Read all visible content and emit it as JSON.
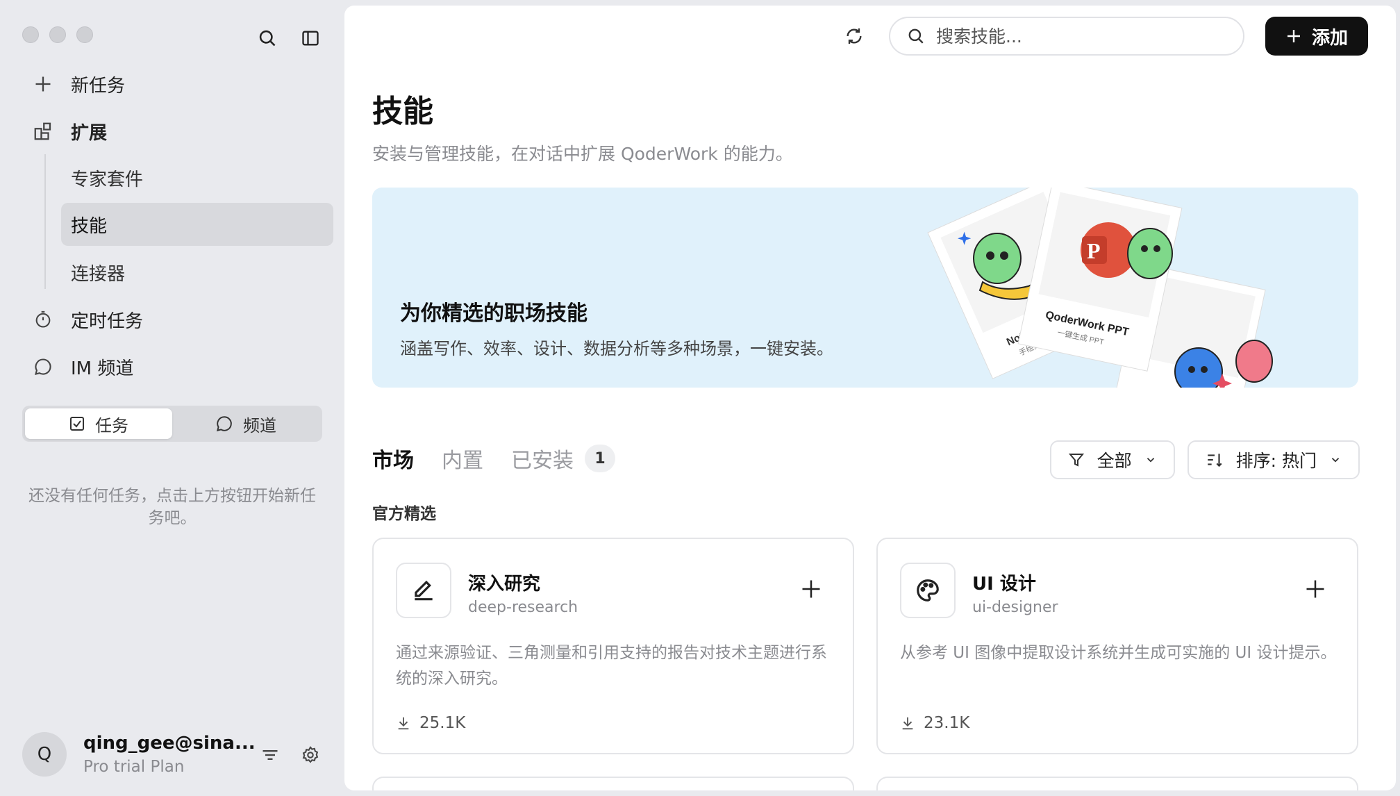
{
  "sidebar": {
    "nav": {
      "new_task": "新任务",
      "extensions": "扩展",
      "scheduled": "定时任务",
      "im_channels": "IM 频道"
    },
    "sub_items": [
      "专家套件",
      "技能",
      "连接器"
    ],
    "segment": {
      "tasks": "任务",
      "channels": "频道"
    },
    "empty_text": "还没有任何任务，点击上方按钮开始新任务吧。",
    "user": {
      "initial": "Q",
      "name": "qing_gee@sina...",
      "plan": "Pro trial Plan"
    }
  },
  "header": {
    "search_placeholder": "搜索技能...",
    "add_label": "添加"
  },
  "page": {
    "title": "技能",
    "subtitle": "安装与管理技能，在对话中扩展 QoderWork 的能力。"
  },
  "banner": {
    "title": "为你精选的职场技能",
    "subtitle": "涵盖写作、效率、设计、数据分析等多种场景，一键安装。",
    "card1_title": "Notion 信息图",
    "card1_sub": "手绘风格信息图",
    "card2_title": "QoderWork PPT",
    "card2_sub": "一键生成 PPT"
  },
  "tabs": {
    "market": "市场",
    "builtin": "内置",
    "installed": "已安装",
    "installed_count": "1"
  },
  "filters": {
    "category": "全部",
    "sort": "排序: 热门"
  },
  "section_label": "官方精选",
  "cards": [
    {
      "name": "深入研究",
      "slug": "deep-research",
      "desc": "通过来源验证、三角测量和引用支持的报告对技术主题进行系统的深入研究。",
      "downloads": "25.1K",
      "icon": "pencil-icon"
    },
    {
      "name": "UI 设计",
      "slug": "ui-designer",
      "desc": "从参考 UI 图像中提取设计系统并生成可实施的 UI 设计提示。",
      "downloads": "23.1K",
      "icon": "palette-icon"
    }
  ],
  "colors": {
    "accent": "#111111",
    "banner_bg": "#e0f1fb",
    "sidebar_bg": "#e9eaee"
  }
}
